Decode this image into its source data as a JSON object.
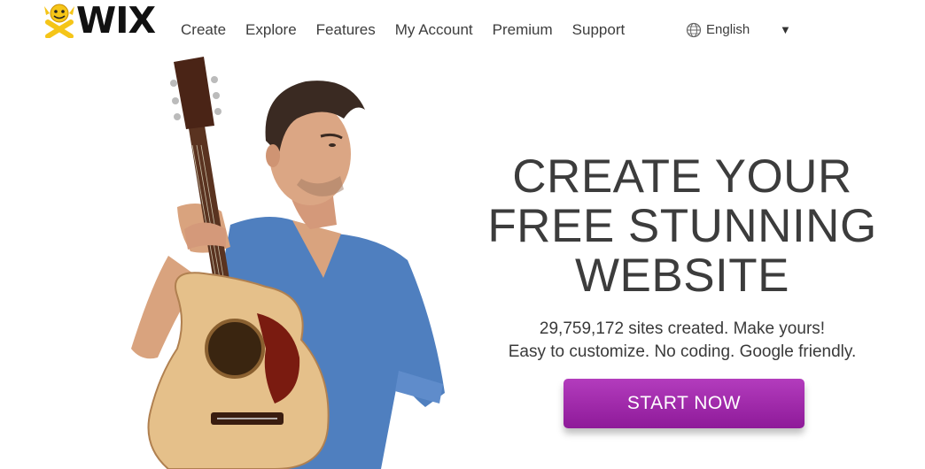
{
  "header": {
    "brand": "WIX",
    "nav": [
      "Create",
      "Explore",
      "Features",
      "My Account",
      "Premium",
      "Support"
    ],
    "language": "English"
  },
  "hero": {
    "headline_lines": [
      "CREATE YOUR",
      "FREE STUNNING",
      "WEBSITE"
    ],
    "stat_line": "29,759,172 sites created. Make yours!",
    "features_line": "Easy to customize. No coding. Google friendly.",
    "cta_label": "START NOW"
  },
  "colors": {
    "cta_purple": "#9c27a8",
    "logo_yellow": "#f5c518",
    "shirt_blue": "#4f7fbf"
  },
  "icons": [
    "wix-mascot-icon",
    "globe-icon",
    "dropdown-caret-icon"
  ]
}
